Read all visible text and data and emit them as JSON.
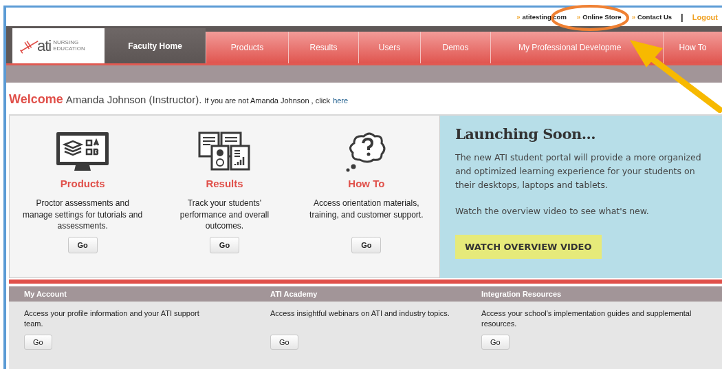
{
  "top_links": [
    {
      "label": "atitesting.com",
      "separator": "»"
    },
    {
      "label": "Online Store",
      "separator": "»"
    },
    {
      "label": "Contact Us",
      "separator": "»"
    }
  ],
  "divider": "|",
  "logout": "Logout",
  "logo": {
    "brand": "ati",
    "subtitle": "NURSING EDUCATION"
  },
  "nav": [
    {
      "label": "Faculty Home",
      "selected": true
    },
    {
      "label": "Products",
      "selected": false
    },
    {
      "label": "Results",
      "selected": false
    },
    {
      "label": "Users",
      "selected": false
    },
    {
      "label": "Demos",
      "selected": false
    },
    {
      "label": "My Professional Developme",
      "selected": false
    },
    {
      "label": "How To",
      "selected": false
    }
  ],
  "welcome": {
    "heading": "Welcome",
    "name": "Amanda Johnson (Instructor).",
    "text": "If you are not Amanda Johnson , click",
    "link": "here"
  },
  "features": [
    {
      "kind": "monitor",
      "title": "Products",
      "description": "Proctor assessments and manage settings for tutorials and assessments.",
      "button": "Go"
    },
    {
      "kind": "reports",
      "title": "Results",
      "description": "Track your students' performance and overall outcomes.",
      "button": "Go"
    },
    {
      "kind": "question",
      "title": "How To",
      "description": "Access orientation materials, training, and customer support.",
      "button": "Go"
    }
  ],
  "promo": {
    "title": "Launching Soon...",
    "body": "The new ATI student portal will provide a more organized and optimized learning experience for your students on their desktops, laptops and tablets.",
    "note": "Watch the overview video to see what's new.",
    "button": "WATCH OVERVIEW VIDEO"
  },
  "sections": [
    {
      "title": "My Account",
      "description": "Access your profile information and your ATI support team.",
      "button": "Go"
    },
    {
      "title": "ATI Academy",
      "description": "Access insightful webinars on ATI and industry topics.",
      "button": "Go"
    },
    {
      "title": "Integration Resources",
      "description": "Access your school's implementation guides and supplemental resources.",
      "button": "Go"
    }
  ]
}
